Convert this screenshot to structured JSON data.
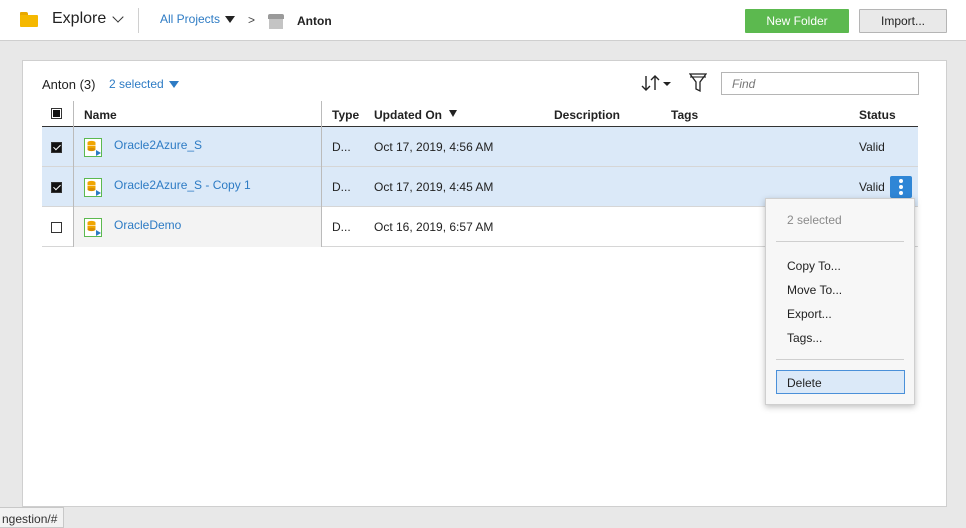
{
  "header": {
    "explore_label": "Explore",
    "breadcrumb_all": "All Projects",
    "breadcrumb_sep": ">",
    "breadcrumb_project": "Anton",
    "new_folder_label": "New Folder",
    "import_label": "Import..."
  },
  "panel": {
    "title": "Anton (3)",
    "selected_label": "2 selected",
    "find_placeholder": "Find"
  },
  "table": {
    "columns": {
      "name": "Name",
      "type": "Type",
      "updated": "Updated On",
      "description": "Description",
      "tags": "Tags",
      "status": "Status"
    },
    "rows": [
      {
        "name": "Oracle2Azure_S",
        "type": "D...",
        "updated": "Oct 17, 2019, 4:56 AM",
        "status": "Valid",
        "selected": true
      },
      {
        "name": "Oracle2Azure_S - Copy 1",
        "type": "D...",
        "updated": "Oct 17, 2019, 4:45 AM",
        "status": "Valid",
        "selected": true
      },
      {
        "name": "OracleDemo",
        "type": "D...",
        "updated": "Oct 16, 2019, 6:57 AM",
        "status": "",
        "selected": false
      }
    ]
  },
  "menu": {
    "header": "2 selected",
    "items": [
      "Copy To...",
      "Move To...",
      "Export...",
      "Tags..."
    ],
    "delete": "Delete"
  },
  "statusbar": {
    "url": "ngestion/#"
  },
  "colors": {
    "accent": "#2d7bc4",
    "new_folder": "#5cb94f",
    "row_selected": "#dbe9f8",
    "action_button": "#2f86d6"
  }
}
